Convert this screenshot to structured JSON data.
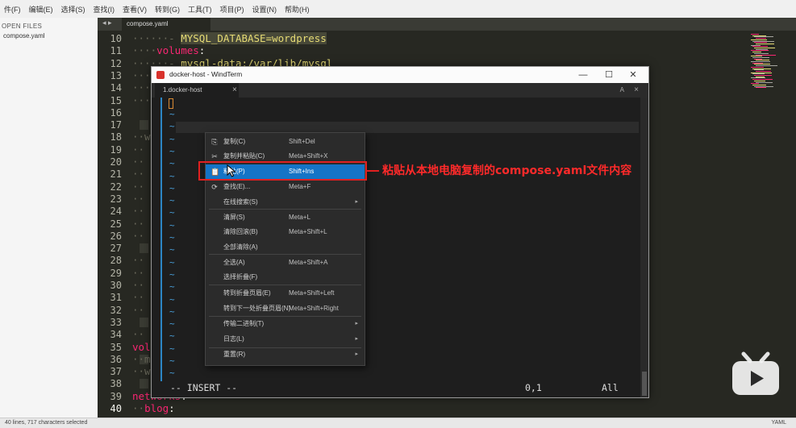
{
  "app": {
    "menubar": [
      "件(F)",
      "编辑(E)",
      "选择(S)",
      "查找(I)",
      "查看(V)",
      "转到(G)",
      "工具(T)",
      "项目(P)",
      "设置(N)",
      "帮助(H)"
    ]
  },
  "sidebar": {
    "header": "OPEN FILES",
    "files": [
      "compose.yaml"
    ]
  },
  "editor": {
    "tab_label": "compose.yaml",
    "tab_nav": "◂ ▸",
    "line_numbers": [
      "10",
      "11",
      "12",
      "13",
      "14",
      "15",
      "16",
      "17",
      "18",
      "19",
      "20",
      "21",
      "22",
      "23",
      "24",
      "25",
      "26",
      "27",
      "28",
      "29",
      "30",
      "31",
      "32",
      "33",
      "34",
      "35",
      "36",
      "37",
      "38",
      "39",
      "40"
    ],
    "visible_code": {
      "line10": "MYSQL_DATABASE=wordpress",
      "line11_key": "volumes",
      "line12": "mysql-data:/var/lib/mysql",
      "line35_key": "vol",
      "line39_key": "networks",
      "line40_key": "blog"
    }
  },
  "statusbar": {
    "left": "40 lines, 717 characters selected",
    "right": "YAML"
  },
  "windterm": {
    "title": "docker-host - WindTerm",
    "tab_label": "1.docker-host",
    "tab_close": "×",
    "tab_a": "A",
    "tab_x": "×",
    "controls": {
      "minimize": "—",
      "maximize": "☐",
      "close": "✕"
    },
    "tilde": "~",
    "mode_text": "-- INSERT --",
    "position": "0,1",
    "scroll_pos": "All"
  },
  "context_menu": {
    "items": [
      {
        "label": "复制(C)",
        "shortcut": "Shift+Del",
        "icon": "copy-icon",
        "glyph": "⎘"
      },
      {
        "label": "复制并粘贴(C)",
        "shortcut": "Meta+Shift+X",
        "icon": "scissors-icon",
        "glyph": "✂"
      },
      {
        "label": "粘贴(P)",
        "shortcut": "Shift+Ins",
        "icon": "paste-icon",
        "glyph": "📋",
        "selected": true
      },
      {
        "label": "查找(E)...",
        "shortcut": "Meta+F",
        "icon": "search-icon",
        "glyph": "⟳"
      },
      {
        "label": "在线搜索(S)",
        "shortcut": "",
        "submenu": true
      },
      {
        "label": "清屏(S)",
        "shortcut": "Meta+L"
      },
      {
        "label": "清除回滚(B)",
        "shortcut": "Meta+Shift+L"
      },
      {
        "label": "全部清除(A)",
        "shortcut": ""
      },
      {
        "label": "全选(A)",
        "shortcut": "Meta+Shift+A"
      },
      {
        "label": "选择折叠(F)",
        "shortcut": ""
      },
      {
        "label": "转到折叠页眉(E)",
        "shortcut": "Meta+Shift+Left"
      },
      {
        "label": "转到下一处折叠页眉(N)",
        "shortcut": "Meta+Shift+Right"
      },
      {
        "label": "传输二进制(T)",
        "shortcut": "",
        "submenu": true
      },
      {
        "label": "日志(L)",
        "shortcut": "",
        "submenu": true
      },
      {
        "label": "重置(R)",
        "shortcut": "",
        "submenu": true
      }
    ],
    "submenu_arrow": "▸"
  },
  "annotation": {
    "text": "粘贴从本地电脑复制的compose.yaml文件内容",
    "color": "#ff2a2a"
  },
  "colors": {
    "editor_bg": "#272822",
    "keyword": "#f92672",
    "string": "#e6db74",
    "menu_selected": "#1574c6"
  }
}
